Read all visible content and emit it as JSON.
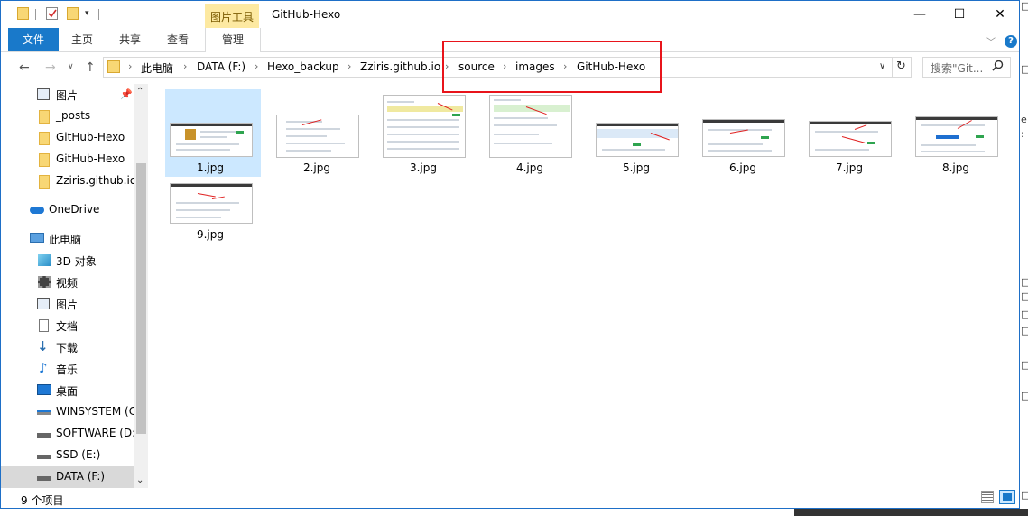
{
  "window": {
    "title": "GitHub-Hexo",
    "context_tab_group": "图片工具",
    "controls": {
      "minimize": "—",
      "maximize": "☐",
      "close": "✕"
    }
  },
  "ribbon": {
    "tabs": [
      {
        "label": "文件"
      },
      {
        "label": "主页"
      },
      {
        "label": "共享"
      },
      {
        "label": "查看"
      },
      {
        "label": "管理"
      }
    ],
    "help_label": "?"
  },
  "address": {
    "crumbs": [
      "此电脑",
      "DATA (F:)",
      "Hexo_backup",
      "Zziris.github.io",
      "source",
      "images",
      "GitHub-Hexo"
    ],
    "search_placeholder": "搜索\"Git..."
  },
  "sidebar": {
    "items": [
      {
        "label": "图片",
        "icon": "pictures-icon",
        "pinned": true
      },
      {
        "label": "_posts",
        "icon": "folder-icon"
      },
      {
        "label": "GitHub-Hexo",
        "icon": "folder-icon"
      },
      {
        "label": "GitHub-Hexo",
        "icon": "folder-icon"
      },
      {
        "label": "Zziris.github.io",
        "icon": "folder-icon"
      },
      {
        "label": "OneDrive",
        "icon": "onedrive-icon"
      },
      {
        "label": "此电脑",
        "icon": "this-pc-icon"
      },
      {
        "label": "3D 对象",
        "icon": "3d-objects-icon"
      },
      {
        "label": "视频",
        "icon": "videos-icon"
      },
      {
        "label": "图片",
        "icon": "pictures-icon"
      },
      {
        "label": "文档",
        "icon": "documents-icon"
      },
      {
        "label": "下载",
        "icon": "downloads-icon"
      },
      {
        "label": "音乐",
        "icon": "music-icon"
      },
      {
        "label": "桌面",
        "icon": "desktop-icon"
      },
      {
        "label": "WINSYSTEM (C",
        "icon": "system-drive-icon"
      },
      {
        "label": "SOFTWARE (D:",
        "icon": "drive-icon"
      },
      {
        "label": "SSD (E:)",
        "icon": "drive-icon"
      },
      {
        "label": "DATA (F:)",
        "icon": "drive-icon",
        "selected": true
      }
    ]
  },
  "files": [
    {
      "name": "1.jpg",
      "selected": true
    },
    {
      "name": "2.jpg"
    },
    {
      "name": "3.jpg"
    },
    {
      "name": "4.jpg"
    },
    {
      "name": "5.jpg"
    },
    {
      "name": "6.jpg"
    },
    {
      "name": "7.jpg"
    },
    {
      "name": "8.jpg"
    },
    {
      "name": "9.jpg"
    }
  ],
  "status": {
    "text": "9 个项目"
  },
  "colors": {
    "accent": "#1979ca",
    "selection": "#cce8ff",
    "highlight_box": "#e8141b",
    "context_tab": "#fde9a1"
  }
}
